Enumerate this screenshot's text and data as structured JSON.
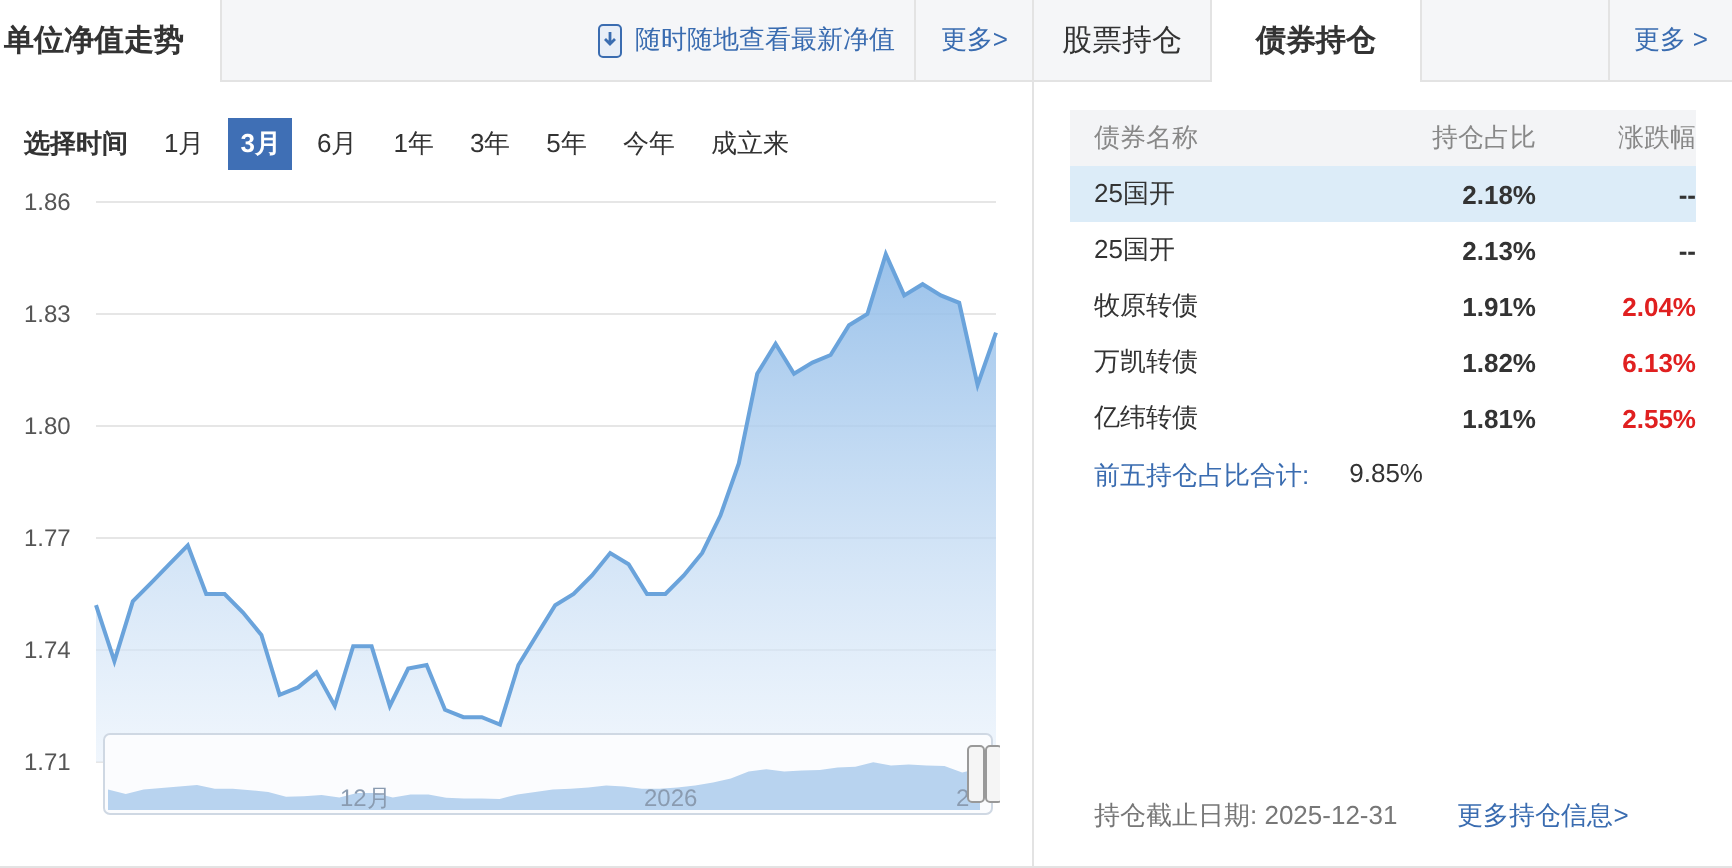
{
  "nav_panel": {
    "title": "单位净值走势",
    "app_link": "随时随地查看最新净值",
    "more": "更多>",
    "range_label": "选择时间",
    "ranges": [
      {
        "label": "1月",
        "selected": false
      },
      {
        "label": "3月",
        "selected": true
      },
      {
        "label": "6月",
        "selected": false
      },
      {
        "label": "1年",
        "selected": false
      },
      {
        "label": "3年",
        "selected": false
      },
      {
        "label": "5年",
        "selected": false
      },
      {
        "label": "今年",
        "selected": false
      },
      {
        "label": "成立来",
        "selected": false
      }
    ],
    "chart_data": {
      "type": "area",
      "grid": true,
      "ylim": [
        1.71,
        1.86
      ],
      "yticks": [
        1.71,
        1.74,
        1.77,
        {
          "value": 1.8,
          "label": "1.80"
        },
        1.83,
        1.86
      ],
      "series": [
        {
          "color": "#6aa3db",
          "values": [
            1.752,
            1.737,
            1.753,
            1.758,
            1.763,
            1.768,
            1.755,
            1.755,
            1.75,
            1.744,
            1.728,
            1.73,
            1.734,
            1.725,
            1.741,
            1.741,
            1.725,
            1.735,
            1.736,
            1.724,
            1.722,
            1.722,
            1.72,
            1.736,
            1.744,
            1.752,
            1.755,
            1.76,
            1.766,
            1.763,
            1.755,
            1.755,
            1.76,
            1.766,
            1.776,
            1.79,
            1.814,
            1.822,
            1.814,
            1.817,
            1.819,
            1.827,
            1.83,
            1.846,
            1.835,
            1.838,
            1.835,
            1.833,
            1.811,
            1.825
          ]
        }
      ]
    },
    "navigator": {
      "labels": [
        "12月",
        "2026",
        "2"
      ]
    }
  },
  "holdings_panel": {
    "tabs": [
      {
        "label": "股票持仓",
        "selected": false
      },
      {
        "label": "债券持仓",
        "selected": true
      }
    ],
    "more": "更多 >",
    "columns": [
      "债券名称",
      "持仓占比",
      "涨跌幅"
    ],
    "rows": [
      {
        "name": "25国开",
        "share": "2.18%",
        "change": "--",
        "color": "#333333",
        "highlighted": true
      },
      {
        "name": "25国开",
        "share": "2.13%",
        "change": "--",
        "color": "#333333",
        "highlighted": false
      },
      {
        "name": "牧原转债",
        "share": "1.91%",
        "change": "2.04%",
        "color": "#e02020",
        "highlighted": false
      },
      {
        "name": "万凯转债",
        "share": "1.82%",
        "change": "6.13%",
        "color": "#e02020",
        "highlighted": false
      },
      {
        "name": "亿纬转债",
        "share": "1.81%",
        "change": "2.55%",
        "color": "#e02020",
        "highlighted": false
      }
    ],
    "total_label": "前五持仓占比合计:",
    "total_value": "9.85%",
    "as_of": "持仓截止日期: 2025-12-31",
    "more_info": "更多持仓信息>"
  }
}
